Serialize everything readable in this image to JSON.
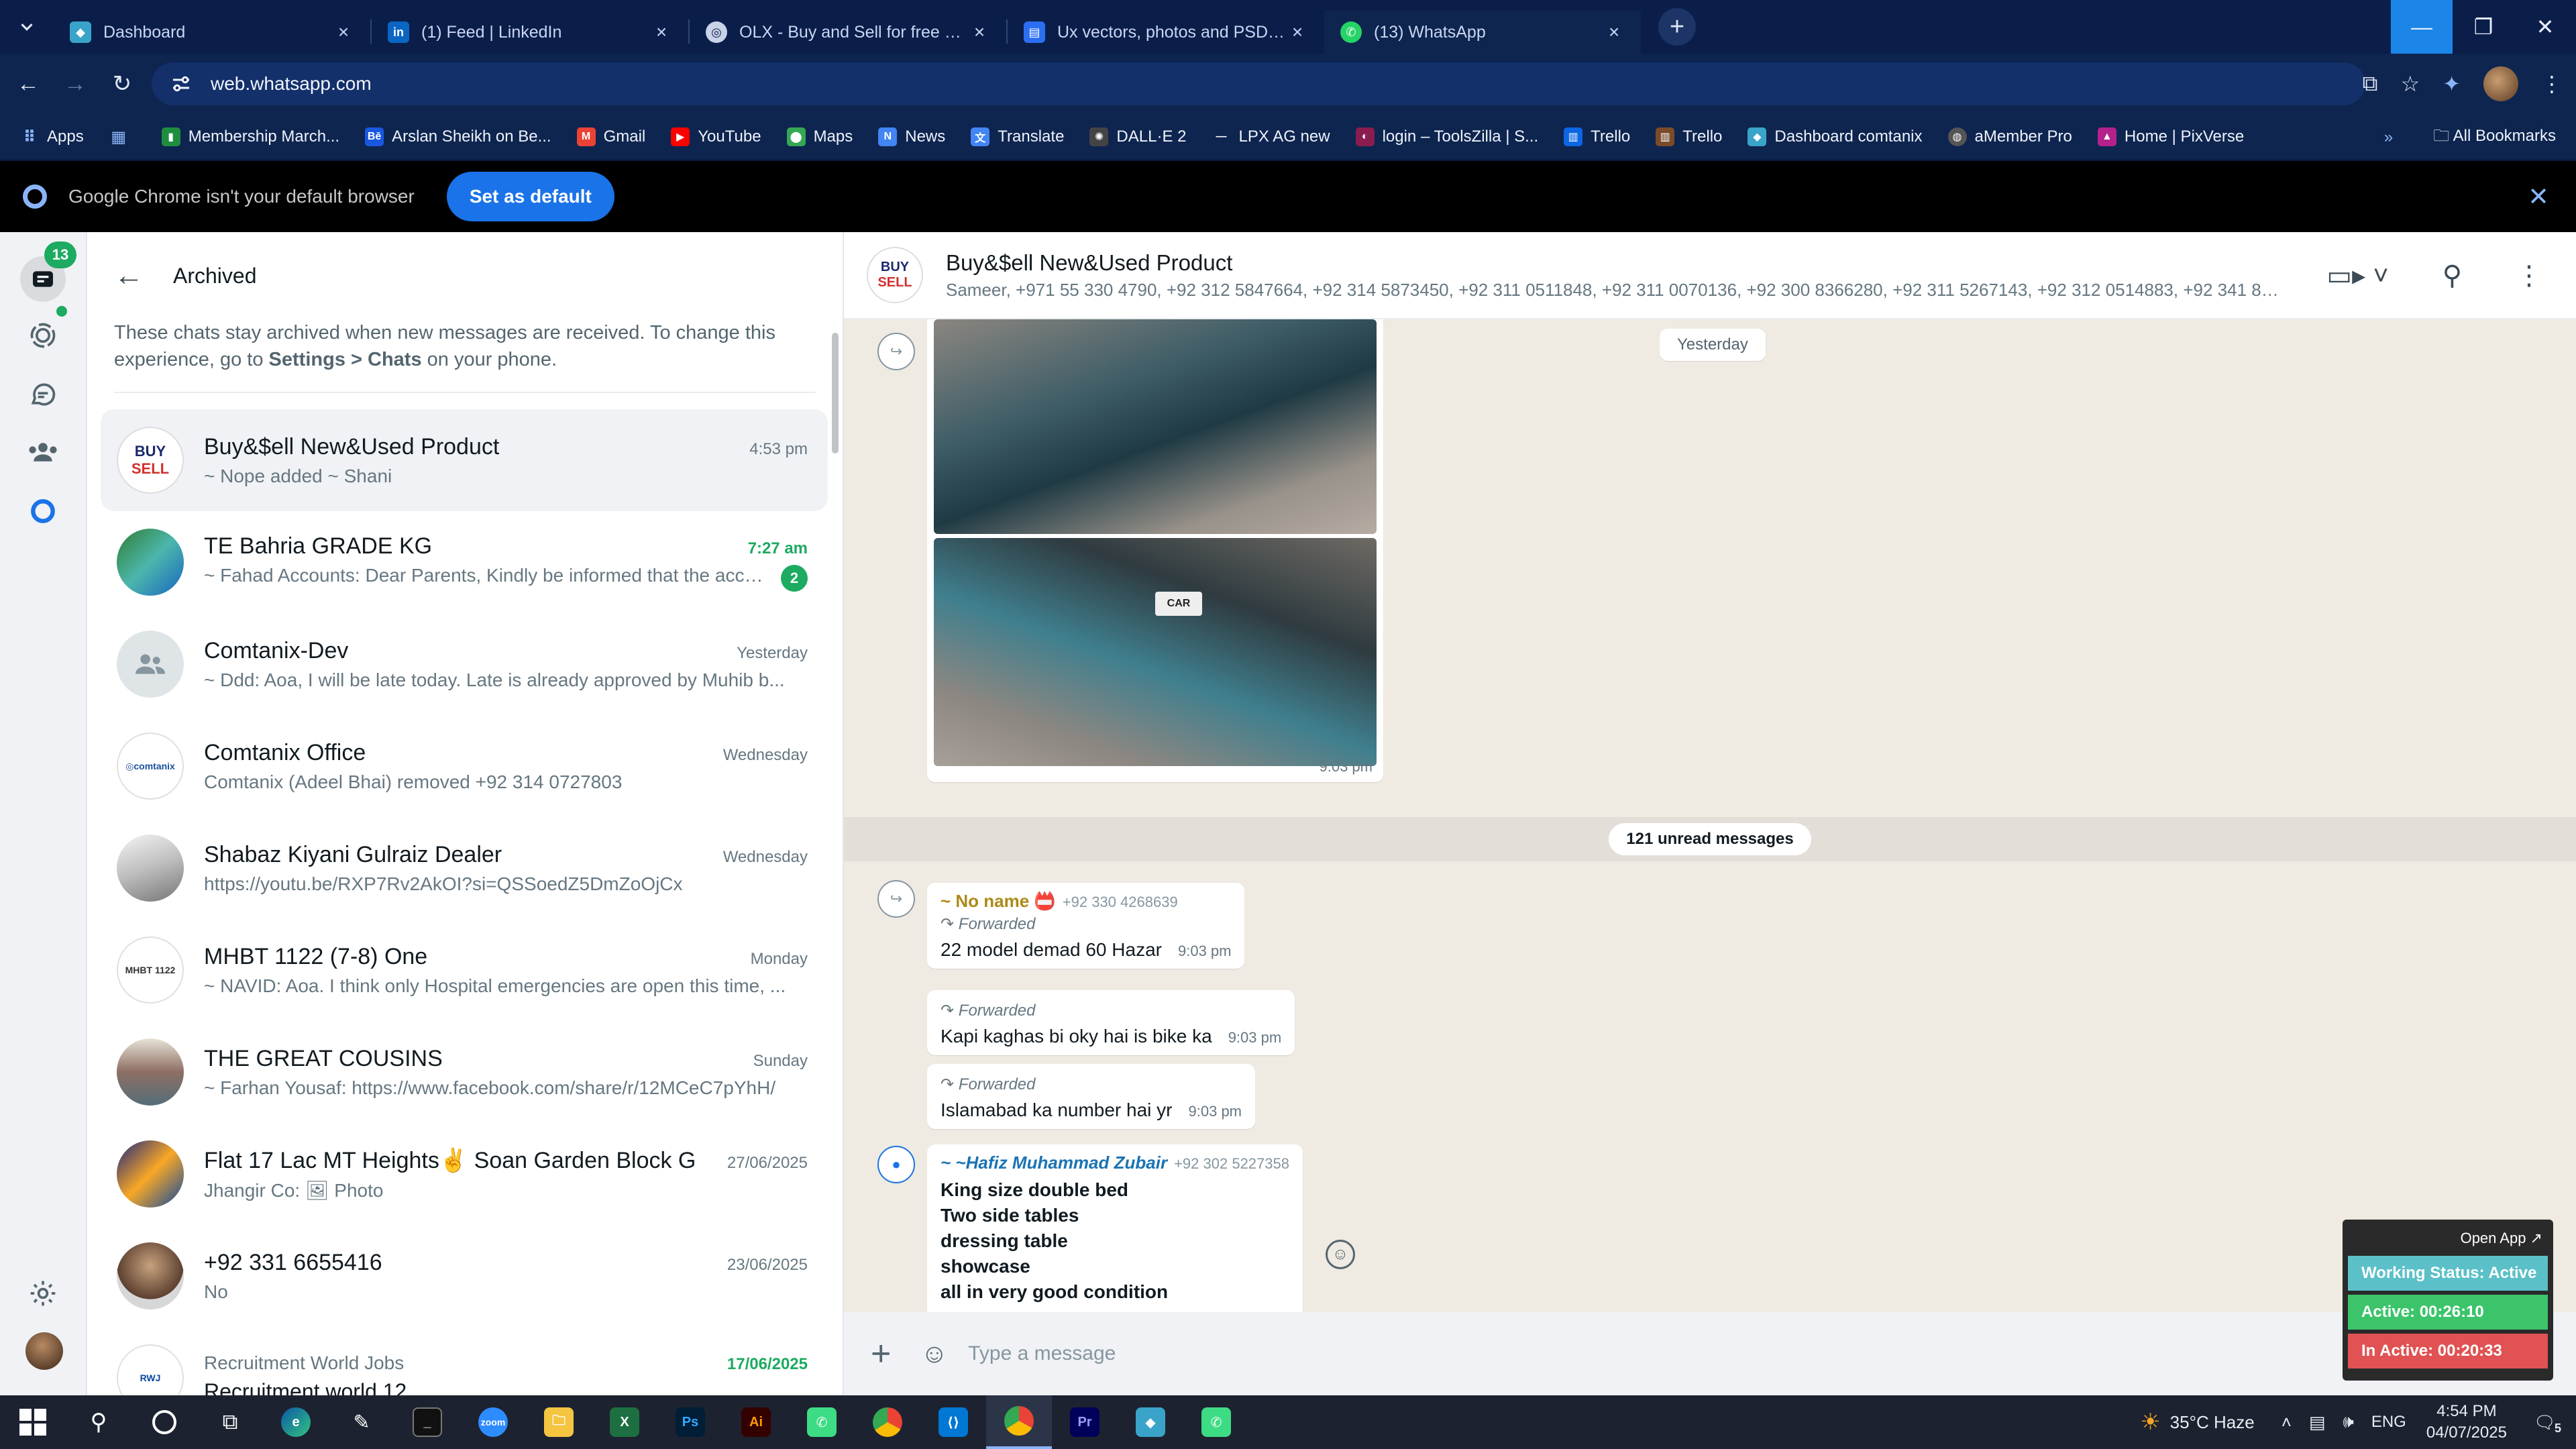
{
  "browser": {
    "tabs": [
      {
        "title": "Dashboard",
        "favicon": "diamond-icon",
        "color": "#3aa3c9"
      },
      {
        "title": "(1) Feed | LinkedIn",
        "favicon": "in",
        "color": "#0a66c2"
      },
      {
        "title": "OLX - Buy and Sell for free anyw",
        "favicon": "olx",
        "color": "#c9d3e8"
      },
      {
        "title": "Ux vectors, photos and PSD files",
        "favicon": "doc-icon",
        "color": "#2b6ef2"
      },
      {
        "title": "(13) WhatsApp",
        "favicon": "whatsapp-icon",
        "color": "#25d366"
      }
    ],
    "url": "web.whatsapp.com",
    "bookmarks": [
      {
        "label": "Apps"
      },
      {
        "label": ""
      },
      {
        "label": "Membership March...",
        "color": "#1e8e3e"
      },
      {
        "label": "Arslan Sheikh on Be...",
        "color": "#1a57e0"
      },
      {
        "label": "Gmail",
        "color": "#ea4335"
      },
      {
        "label": "YouTube",
        "color": "#ff0000"
      },
      {
        "label": "Maps",
        "color": "#34a853"
      },
      {
        "label": "News",
        "color": "#4285f4"
      },
      {
        "label": "Translate",
        "color": "#4285f4"
      },
      {
        "label": "DALL·E 2",
        "color": "#444"
      },
      {
        "label": "LPX AG new",
        "color": "#444"
      },
      {
        "label": "login – ToolsZilla | S...",
        "color": "#8b1c4f"
      },
      {
        "label": "Trello",
        "color": "#0c66e4"
      },
      {
        "label": "Trello",
        "color": "#0c66e4"
      },
      {
        "label": "Dashboard comtanix",
        "color": "#3aa3c9"
      },
      {
        "label": "aMember Pro",
        "color": "#555"
      },
      {
        "label": "Home | PixVerse",
        "color": "#b5218c"
      }
    ],
    "all_bookmarks": "All Bookmarks",
    "infobar_text": "Google Chrome isn't your default browser",
    "infobar_button": "Set as default"
  },
  "whatsapp": {
    "unread_badge": "13",
    "archived_title": "Archived",
    "archived_note_1": "These chats stay archived when new messages are received. To change this experience, go to ",
    "archived_note_settings": "Settings > Chats",
    "archived_note_2": " on your phone.",
    "chats": [
      {
        "name": "Buy&$ell New&Used Product",
        "time": "4:53 pm",
        "preview": "~ Nope added ~ Shani",
        "unread": "",
        "green": false
      },
      {
        "name": "TE Bahria GRADE KG",
        "time": "7:27 am",
        "preview": "~ Fahad Accounts: Dear Parents, Kindly be informed that the acco...",
        "unread": "2",
        "green": true
      },
      {
        "name": "Comtanix-Dev",
        "time": "Yesterday",
        "preview": "~ Ddd: Aoa, I will be late today. Late is already approved by Muhib b...",
        "unread": "",
        "green": false
      },
      {
        "name": "Comtanix Office",
        "time": "Wednesday",
        "preview": "Comtanix (Adeel Bhai) removed +92 314 0727803",
        "unread": "",
        "green": false
      },
      {
        "name": "Shabaz Kiyani Gulraiz Dealer",
        "time": "Wednesday",
        "preview": "https://youtu.be/RXP7Rv2AkOI?si=QSSoedZ5DmZoOjCx",
        "unread": "",
        "green": false
      },
      {
        "name": "MHBT 1122 (7-8) One",
        "time": "Monday",
        "preview": "~ NAVID: Aoa. I think only Hospital emergencies are open this time, ...",
        "unread": "",
        "green": false
      },
      {
        "name": "THE GREAT COUSINS",
        "time": "Sunday",
        "preview": "~ Farhan Yousaf: https://www.facebook.com/share/r/12MCeC7pYhH/",
        "unread": "",
        "green": false
      },
      {
        "name": "Flat 17 Lac MT Heights✌️  Soan Garden Block G",
        "time": "27/06/2025",
        "preview": "Jhangir Co: 🖼 Photo",
        "unread": "",
        "green": false
      },
      {
        "name": "+92 331 6655416",
        "time": "23/06/2025",
        "preview": "No",
        "unread": "",
        "green": false
      },
      {
        "name": "Recruitment World Jobs",
        "time": "17/06/2025",
        "preview": "Recruitment world 12",
        "unread": "",
        "green": true
      }
    ],
    "conversation": {
      "title": "Buy&$ell New&Used Product",
      "members": "Sameer, +971 55 330 4790, +92 312 5847664, +92 314 5873450, +92 311 0511848, +92 311 0070136, +92 300 8366280, +92 311 5267143, +92 312 0514883, +92 341 88619...",
      "day_label": "Yesterday",
      "image_time": "9:03 pm",
      "unread_label": "121 unread messages",
      "msg1_sender": "~ No name 📛",
      "msg1_phone": "+92 330 4268639",
      "forwarded": "Forwarded",
      "msg1_text": "22 model demad 60 Hazar",
      "msg1_time": "9:03 pm",
      "msg2_text": "Kapi kaghas bi oky hai is bike ka",
      "msg2_time": "9:03 pm",
      "msg3_text": "Islamabad ka number hai yr",
      "msg3_time": "9:03 pm",
      "msg4_sender": "~ ~Hafiz Muhammad Zubair",
      "msg4_phone": "+92 302 5227358",
      "msg4_lines": [
        "King size double bed",
        "Two side tables",
        "dressing table",
        "showcase",
        "all in very good condition"
      ],
      "composer_placeholder": "Type a message"
    }
  },
  "widget": {
    "open_app": "Open App ↗",
    "status": "Working Status: Active",
    "active": "Active: 00:26:10",
    "inactive": "In Active: 00:20:33"
  },
  "taskbar": {
    "weather": "35°C  Haze",
    "lang": "ENG",
    "time": "4:54 PM",
    "date": "04/07/2025",
    "notifications": "5"
  }
}
